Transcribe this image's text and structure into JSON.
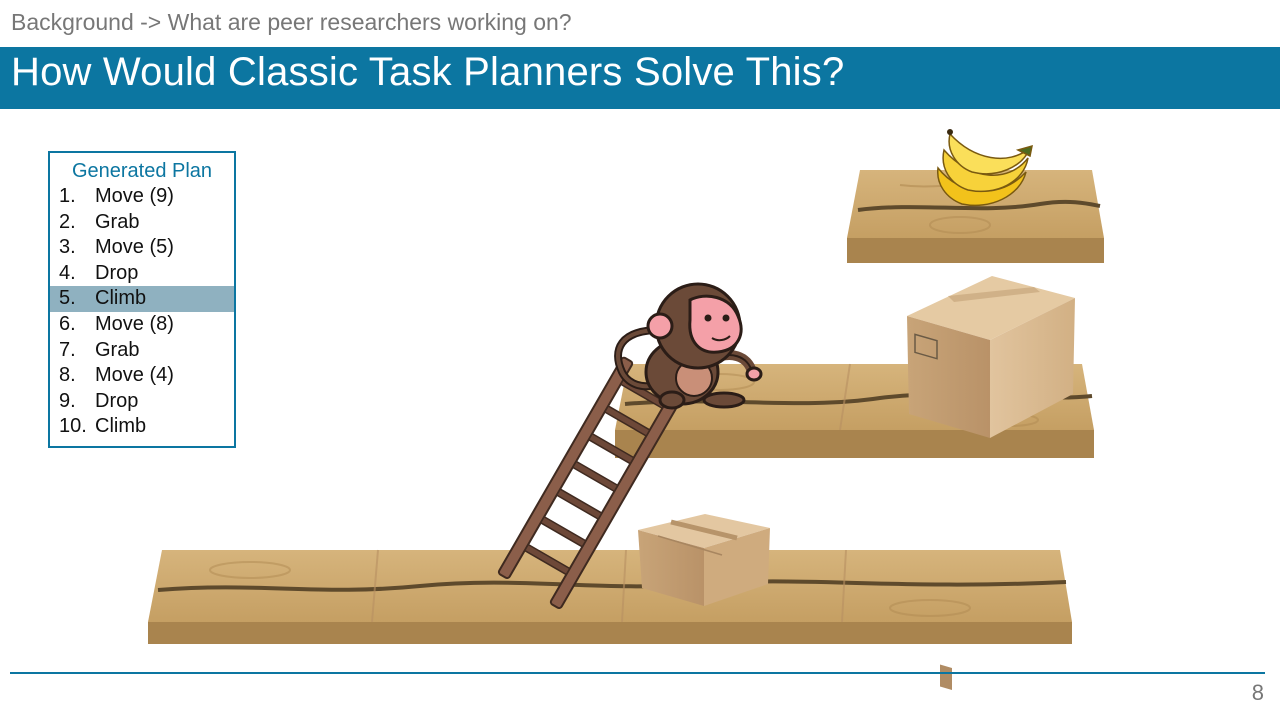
{
  "breadcrumb": "Background -> What are peer researchers working on?",
  "title": "How Would Classic Task Planners Solve This?",
  "plan": {
    "title": "Generated Plan",
    "active_step": 5,
    "steps": [
      {
        "num": "1.",
        "text": "Move (9)"
      },
      {
        "num": "2.",
        "text": "Grab"
      },
      {
        "num": "3.",
        "text": "Move (5)"
      },
      {
        "num": "4.",
        "text": "Drop"
      },
      {
        "num": "5.",
        "text": "Climb"
      },
      {
        "num": "6.",
        "text": "Move (8)"
      },
      {
        "num": "7.",
        "text": "Grab"
      },
      {
        "num": "8.",
        "text": "Move (4)"
      },
      {
        "num": "9.",
        "text": "Drop"
      },
      {
        "num": "10.",
        "text": "Climb"
      }
    ]
  },
  "scene": {
    "objects": [
      "wooden-platform-floor",
      "wooden-platform-middle",
      "wooden-platform-top",
      "ladder",
      "box-small",
      "box-large",
      "monkey",
      "bananas"
    ]
  },
  "colors": {
    "accent": "#0c76a1",
    "highlight": "#8fb1c0",
    "wood": "#c9a36b",
    "wood_dark": "#a9844e",
    "grain": "#5e4a2c"
  },
  "page_number": "8"
}
